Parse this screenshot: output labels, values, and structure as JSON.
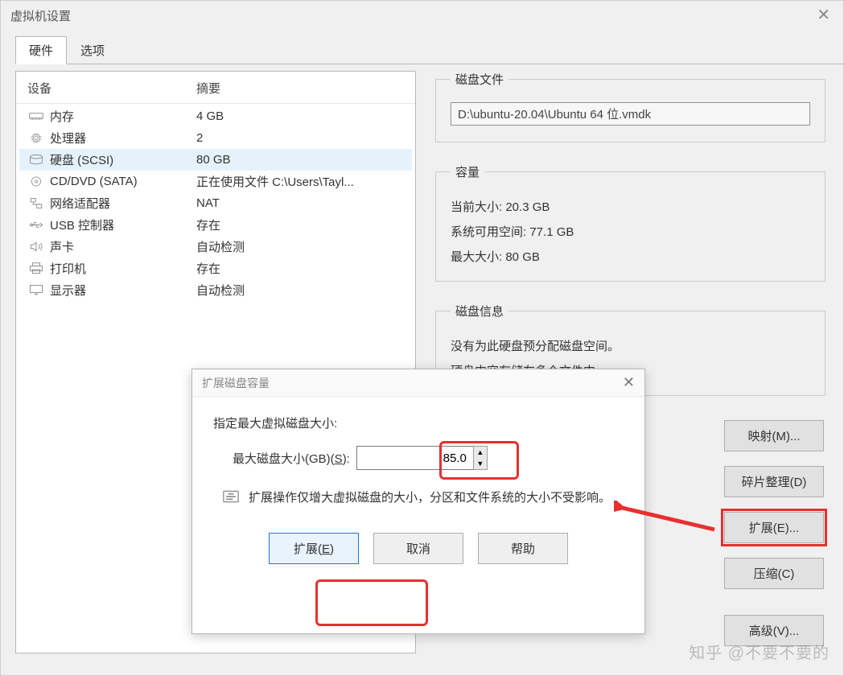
{
  "window": {
    "title": "虚拟机设置"
  },
  "tabs": {
    "hardware": "硬件",
    "options": "选项"
  },
  "headers": {
    "device": "设备",
    "summary": "摘要"
  },
  "devices": [
    {
      "icon": "memory-icon",
      "name": "内存",
      "summary": "4 GB"
    },
    {
      "icon": "cpu-icon",
      "name": "处理器",
      "summary": "2"
    },
    {
      "icon": "disk-icon",
      "name": "硬盘 (SCSI)",
      "summary": "80 GB",
      "selected": true
    },
    {
      "icon": "cd-icon",
      "name": "CD/DVD (SATA)",
      "summary": "正在使用文件 C:\\Users\\Tayl..."
    },
    {
      "icon": "net-icon",
      "name": "网络适配器",
      "summary": "NAT"
    },
    {
      "icon": "usb-icon",
      "name": "USB 控制器",
      "summary": "存在"
    },
    {
      "icon": "sound-icon",
      "name": "声卡",
      "summary": "自动检测"
    },
    {
      "icon": "printer-icon",
      "name": "打印机",
      "summary": "存在"
    },
    {
      "icon": "display-icon",
      "name": "显示器",
      "summary": "自动检测"
    }
  ],
  "disk_file": {
    "group_title": "磁盘文件",
    "value": "D:\\ubuntu-20.04\\Ubuntu 64 位.vmdk"
  },
  "capacity": {
    "group_title": "容量",
    "current_label": "当前大小:",
    "current_value": "20.3 GB",
    "free_label": "系统可用空间:",
    "free_value": "77.1 GB",
    "max_label": "最大大小:",
    "max_value": "80 GB"
  },
  "disk_info": {
    "group_title": "磁盘信息",
    "line1": "没有为此硬盘预分配磁盘空间。",
    "line2": "硬盘内容存储在多个文件中。"
  },
  "util_buttons": {
    "map": "映射(M)...",
    "defrag": "碎片整理(D)",
    "expand": "扩展(E)...",
    "compress": "压缩(C)",
    "advanced": "高级(V)..."
  },
  "modal": {
    "title": "扩展磁盘容量",
    "instruction": "指定最大虚拟磁盘大小:",
    "field_label_pre": "最大磁盘大小(GB)(",
    "field_label_key": "S",
    "field_label_post": "):",
    "field_value": "85.0",
    "note": "扩展操作仅增大虚拟磁盘的大小，分区和文件系统的大小不受影响。",
    "btn_expand": "扩展(E)",
    "btn_expand_key": "E",
    "btn_cancel": "取消",
    "btn_help": "帮助"
  },
  "watermark": "知乎 @不要不要的"
}
